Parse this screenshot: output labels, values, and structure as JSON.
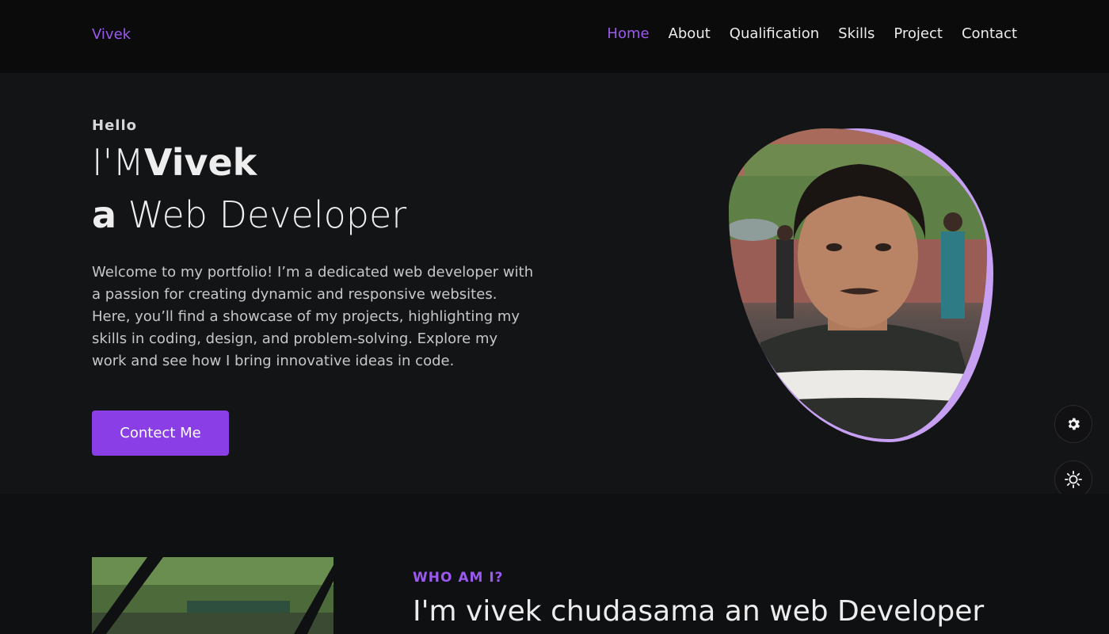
{
  "brand": "Vivek",
  "nav": {
    "items": [
      "Home",
      "About",
      "Qualification",
      "Skills",
      "Project",
      "Contact"
    ],
    "active": "Home"
  },
  "hero": {
    "greeting": "Hello",
    "im": "I'M",
    "name": "Vivek",
    "article": "a",
    "role": "Web Developer",
    "intro": "Welcome to my portfolio! I’m a dedicated web developer with a passion for creating dynamic and responsive websites. Here, you’ll find a showcase of my projects, highlighting my skills in coding, design, and problem-solving. Explore my work and see how I bring innovative ideas in code.",
    "cta": "Contect Me"
  },
  "about": {
    "eyebrow": "WHO AM I?",
    "title": "I'm vivek chudasama an web Developer"
  },
  "colors": {
    "accent": "#9b59f0",
    "button": "#8a3ee6",
    "background": "#131416",
    "navbar": "#0b0b0c",
    "blob": "#c7a0f4"
  },
  "icons": {
    "settings": "gear-icon",
    "theme": "sun-icon"
  }
}
